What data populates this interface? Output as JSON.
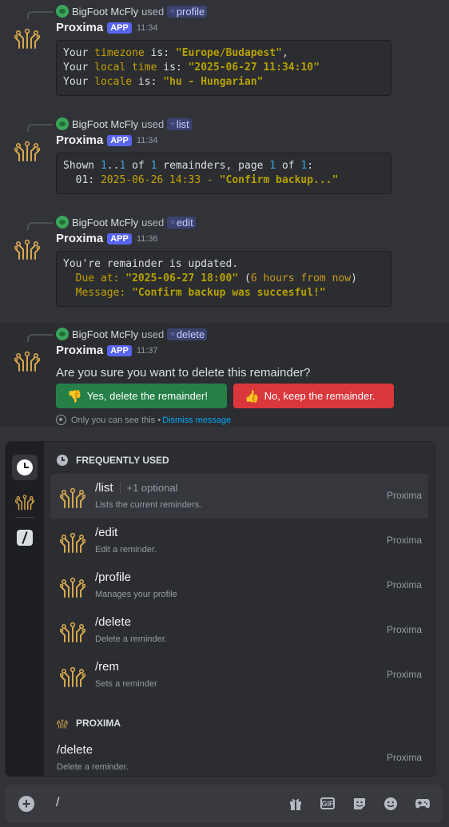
{
  "bot": {
    "name": "Proxima",
    "badge": "APP"
  },
  "messages": [
    {
      "reply_user": "BigFoot McFly",
      "used": "used",
      "command": "profile",
      "time": "11:34",
      "lines": [
        [
          [
            "Your ",
            "t"
          ],
          [
            "timezone",
            "y"
          ],
          [
            " is: ",
            "t"
          ],
          [
            "\"Europe/Budapest\"",
            "yb"
          ],
          [
            ",",
            "t"
          ]
        ],
        [
          [
            "Your ",
            "t"
          ],
          [
            "local time",
            "y"
          ],
          [
            " is: ",
            "t"
          ],
          [
            "\"2025-06-27 11:34:10\"",
            "yb"
          ]
        ],
        [
          [
            "Your ",
            "t"
          ],
          [
            "locale",
            "y"
          ],
          [
            " is: ",
            "t"
          ],
          [
            "\"hu - Hungarian\"",
            "yb"
          ]
        ]
      ]
    },
    {
      "reply_user": "BigFoot McFly",
      "used": "used",
      "command": "list",
      "time": "11:34",
      "lines": [
        [
          [
            "Shown ",
            "t"
          ],
          [
            "1",
            "bl"
          ],
          [
            "..",
            "t"
          ],
          [
            "1",
            "bl"
          ],
          [
            " of ",
            "t"
          ],
          [
            "1",
            "bl"
          ],
          [
            " remainders, page ",
            "t"
          ],
          [
            "1",
            "bl"
          ],
          [
            " of ",
            "t"
          ],
          [
            "1",
            "bl"
          ],
          [
            ":",
            "t"
          ]
        ],
        [
          [
            "  01: ",
            "t"
          ],
          [
            "2025-06-26 14:33 - ",
            "y"
          ],
          [
            "\"Confirm backup...\"",
            "yb"
          ]
        ]
      ]
    },
    {
      "reply_user": "BigFoot McFly",
      "used": "used",
      "command": "edit",
      "time": "11:36",
      "lines": [
        [
          [
            "You're remainder is updated.",
            "t"
          ]
        ],
        [
          [
            "  Due at: ",
            "y"
          ],
          [
            "\"2025-06-27 18:00\"",
            "yb"
          ],
          [
            " (",
            "t"
          ],
          [
            "6 hours from now",
            "yo"
          ],
          [
            ")",
            "t"
          ]
        ],
        [
          [
            "  Message: ",
            "y"
          ],
          [
            "\"Confirm backup was succesful!\"",
            "yb"
          ]
        ]
      ]
    },
    {
      "reply_user": "BigFoot McFly",
      "used": "used",
      "command": "delete",
      "time": "11:37",
      "question": "Are you sure you want to delete this remainder?",
      "buttons": [
        {
          "emoji": "👎",
          "label": "Yes, delete the remainder!"
        },
        {
          "emoji": "👍",
          "label": "No, keep the remainder."
        }
      ],
      "ephemeral_note": "Only you can see this •",
      "dismiss": "Dismiss message"
    }
  ],
  "picker": {
    "section_frequent": "FREQUENTLY USED",
    "section_app": "PROXIMA",
    "frequent": [
      {
        "name": "/list",
        "optional": "+1 optional",
        "desc": "Lists the current reminders.",
        "source": "Proxima"
      },
      {
        "name": "/edit",
        "desc": "Edit a reminder.",
        "source": "Proxima"
      },
      {
        "name": "/profile",
        "desc": "Manages your profile",
        "source": "Proxima"
      },
      {
        "name": "/delete",
        "desc": "Delete a reminder.",
        "source": "Proxima"
      },
      {
        "name": "/rem",
        "desc": "Sets a reminder",
        "source": "Proxima"
      }
    ],
    "app_commands": [
      {
        "name": "/delete",
        "desc": "Delete a reminder.",
        "source": "Proxima"
      }
    ]
  },
  "composer": {
    "value": "/"
  },
  "colors": {
    "accent": "#5865f2",
    "success": "#248046",
    "danger": "#da373c",
    "link": "#00a8fc"
  }
}
